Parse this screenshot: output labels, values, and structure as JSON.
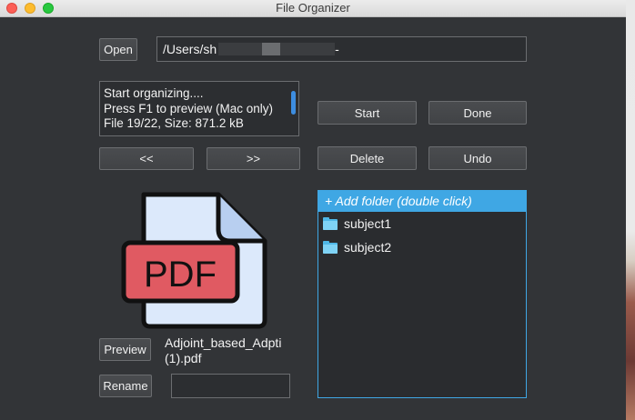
{
  "window": {
    "title": "File Organizer"
  },
  "toolbar": {
    "open_label": "Open",
    "path_visible": "/Users/sh",
    "path_tail": "-"
  },
  "log": {
    "lines": [
      "Start organizing....",
      "Press F1 to preview (Mac only)",
      "File 19/22, Size: 871.2 kB"
    ]
  },
  "nav": {
    "prev_label": "<<",
    "next_label": ">>"
  },
  "actions": {
    "start_label": "Start",
    "done_label": "Done",
    "delete_label": "Delete",
    "undo_label": "Undo"
  },
  "preview": {
    "badge_text": "PDF",
    "file_name_line1": "Adjoint_based_Adpti",
    "file_name_line2": "(1).pdf",
    "preview_label": "Preview",
    "rename_label": "Rename",
    "rename_value": ""
  },
  "folders": {
    "add_label": "+ Add folder (double click)",
    "items": [
      "subject1",
      "subject2"
    ]
  },
  "colors": {
    "accent": "#3fa7e4",
    "pdf_red": "#e05a62",
    "pdf_page": "#dce9fb"
  }
}
